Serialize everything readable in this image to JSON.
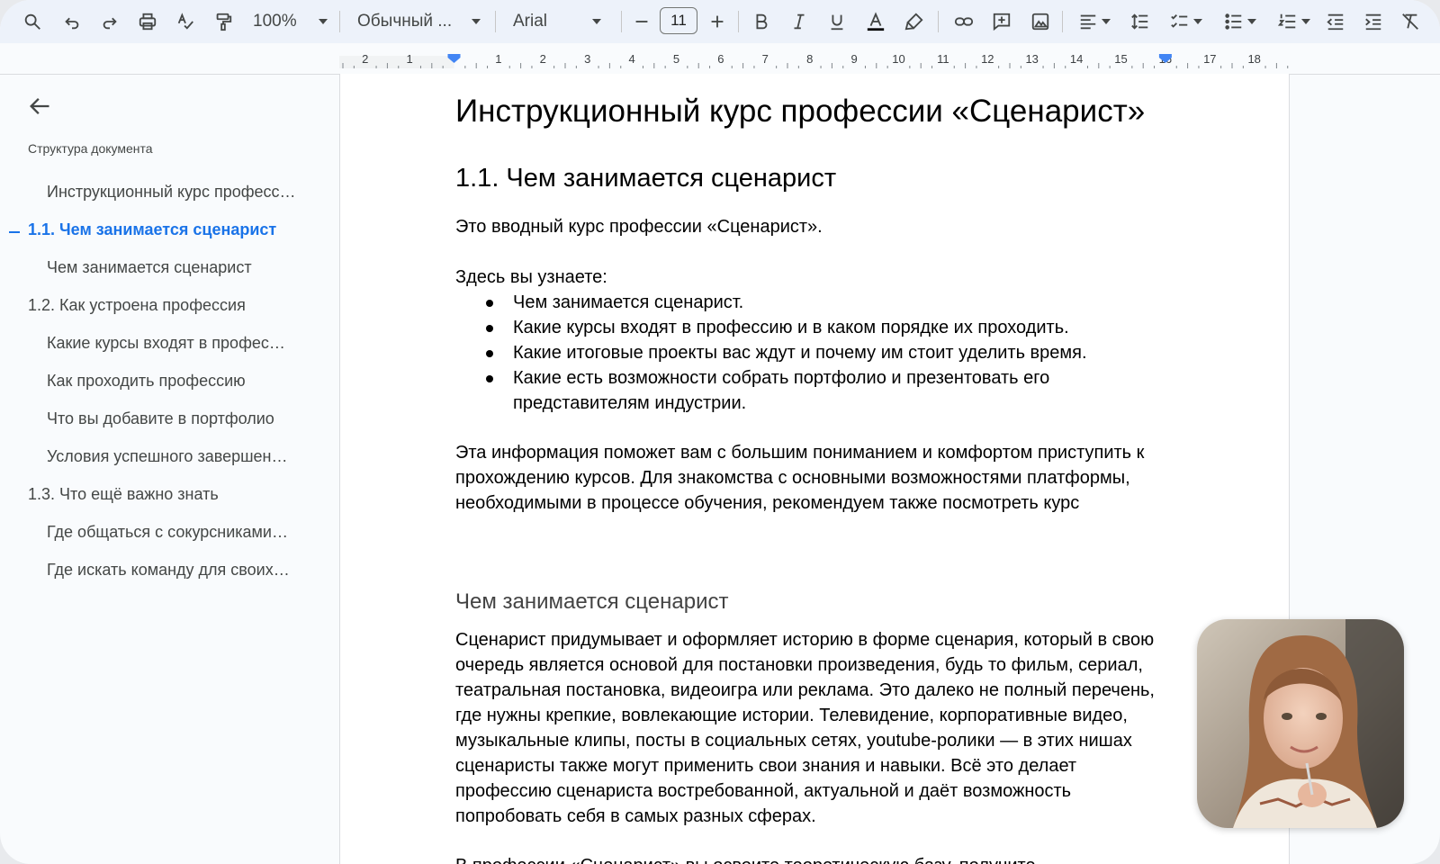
{
  "toolbar": {
    "zoom": "100%",
    "style": "Обычный ...",
    "font": "Arial",
    "font_size": "11",
    "colors": {
      "text_color_underline": "#000000",
      "accent": "#1a73e8"
    }
  },
  "ruler": {
    "labels": [
      "2",
      "1",
      "1",
      "2",
      "3",
      "4",
      "5",
      "6",
      "7",
      "8",
      "9",
      "10",
      "11",
      "12",
      "13",
      "14",
      "15",
      "16",
      "17",
      "18"
    ]
  },
  "sidebar": {
    "title": "Структура документа",
    "items": [
      {
        "label": "Инструкционный курс професс…",
        "level": 3
      },
      {
        "label": "1.1. Чем занимается сценарист",
        "level": 2,
        "active": true
      },
      {
        "label": "Чем занимается сценарист",
        "level": 3
      },
      {
        "label": "1.2. Как устроена профессия",
        "level": 2
      },
      {
        "label": "Какие курсы входят в профес…",
        "level": 3
      },
      {
        "label": "Как проходить профессию",
        "level": 3
      },
      {
        "label": "Что вы добавите в портфолио",
        "level": 3
      },
      {
        "label": "Условия успешного завершен…",
        "level": 3
      },
      {
        "label": "1.3. Что ещё важно знать",
        "level": 2
      },
      {
        "label": "Где общаться с сокурсниками…",
        "level": 3
      },
      {
        "label": "Где искать команду для своих…",
        "level": 3
      }
    ]
  },
  "doc": {
    "title": "Инструкционный курс профессии «Сценарист»",
    "h2": "1.1. Чем занимается сценарист",
    "intro": "Это вводный курс профессии «Сценарист».",
    "learn_heading": "Здесь вы узнаете:",
    "bullets": [
      "Чем занимается сценарист.",
      "Какие курсы входят в профессию и в каком порядке их проходить.",
      "Какие итоговые проекты вас ждут и почему им стоит уделить время.",
      "Какие есть возможности собрать портфолио и презентовать его представителям индустрии."
    ],
    "info_paragraph": "Эта информация поможет вам с большим пониманием и комфортом приступить к прохождению курсов. Для знакомства с основными возможностями платформы, необходимыми в процессе обучения, рекомендуем также посмотреть курс",
    "h3": "Чем занимается сценарист",
    "body_paragraph": "Сценарист придумывает и оформляет историю в форме сценария, который в свою очередь является основой для постановки произведения, будь то фильм, сериал, театральная постановка, видеоигра или реклама. Это далеко не полный перечень, где нужны крепкие, вовлекающие истории. Телевидение, корпоративные видео, музыкальные клипы, посты в социальных сетях, youtube-ролики — в этих нишах сценаристы также могут применить свои знания и навыки. Всё это делает профессию сценариста востребованной, актуальной и даёт возможность попробовать себя в самых разных сферах.",
    "cut_line": "В профессии «Сценарист» вы освоите теоретическую базу, получите"
  }
}
